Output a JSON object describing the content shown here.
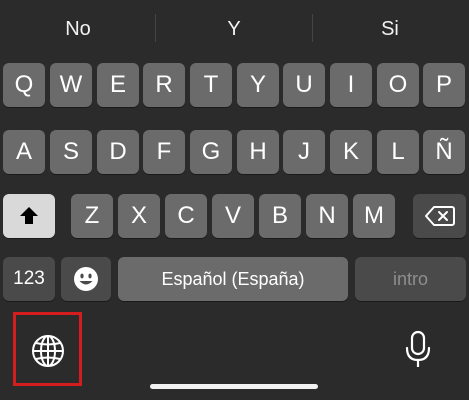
{
  "suggestions": [
    "No",
    "Y",
    "Si"
  ],
  "rows": {
    "row1": [
      "Q",
      "W",
      "E",
      "R",
      "T",
      "Y",
      "U",
      "I",
      "O",
      "P"
    ],
    "row2": [
      "A",
      "S",
      "D",
      "F",
      "G",
      "H",
      "J",
      "K",
      "L",
      "Ñ"
    ],
    "row3": [
      "Z",
      "X",
      "C",
      "V",
      "B",
      "N",
      "M"
    ]
  },
  "bottom": {
    "numbers_label": "123",
    "space_label": "Español (España)",
    "return_label": "intro"
  },
  "icons": {
    "shift": "shift-icon",
    "delete": "delete-icon",
    "emoji": "emoji-icon",
    "globe": "globe-icon",
    "mic": "microphone-icon"
  },
  "colors": {
    "background": "#2b2b2b",
    "key": "#6b6b6b",
    "dark_key": "#4a4a4a",
    "shift_key": "#d9d9d9",
    "highlight": "#d41e1e"
  }
}
